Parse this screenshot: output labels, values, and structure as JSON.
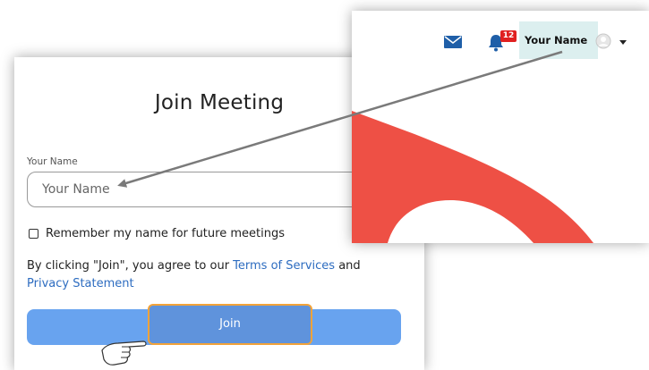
{
  "join_dialog": {
    "title": "Join Meeting",
    "name_label": "Your Name",
    "name_placeholder": "Your Name",
    "remember_label": "Remember my name for future meetings",
    "agree_prefix": "By clicking \"Join\", you agree to our ",
    "terms_link": "Terms of Services",
    "agree_middle": " and ",
    "privacy_link": "Privacy Statement",
    "join_label": "Join"
  },
  "header_inset": {
    "notification_count": "12",
    "user_name": "Your Name"
  },
  "colors": {
    "join_button": "#68a3ef",
    "highlight_border": "#f2a33a",
    "link": "#2d6cc0",
    "brand_red": "#ee5045",
    "badge": "#e02020",
    "mail_icon": "#1f5fa8",
    "name_highlight": "#dcefef"
  },
  "icons": [
    "mail-icon",
    "bell-icon",
    "avatar-icon",
    "caret-down-icon",
    "pointing-hand-icon"
  ]
}
